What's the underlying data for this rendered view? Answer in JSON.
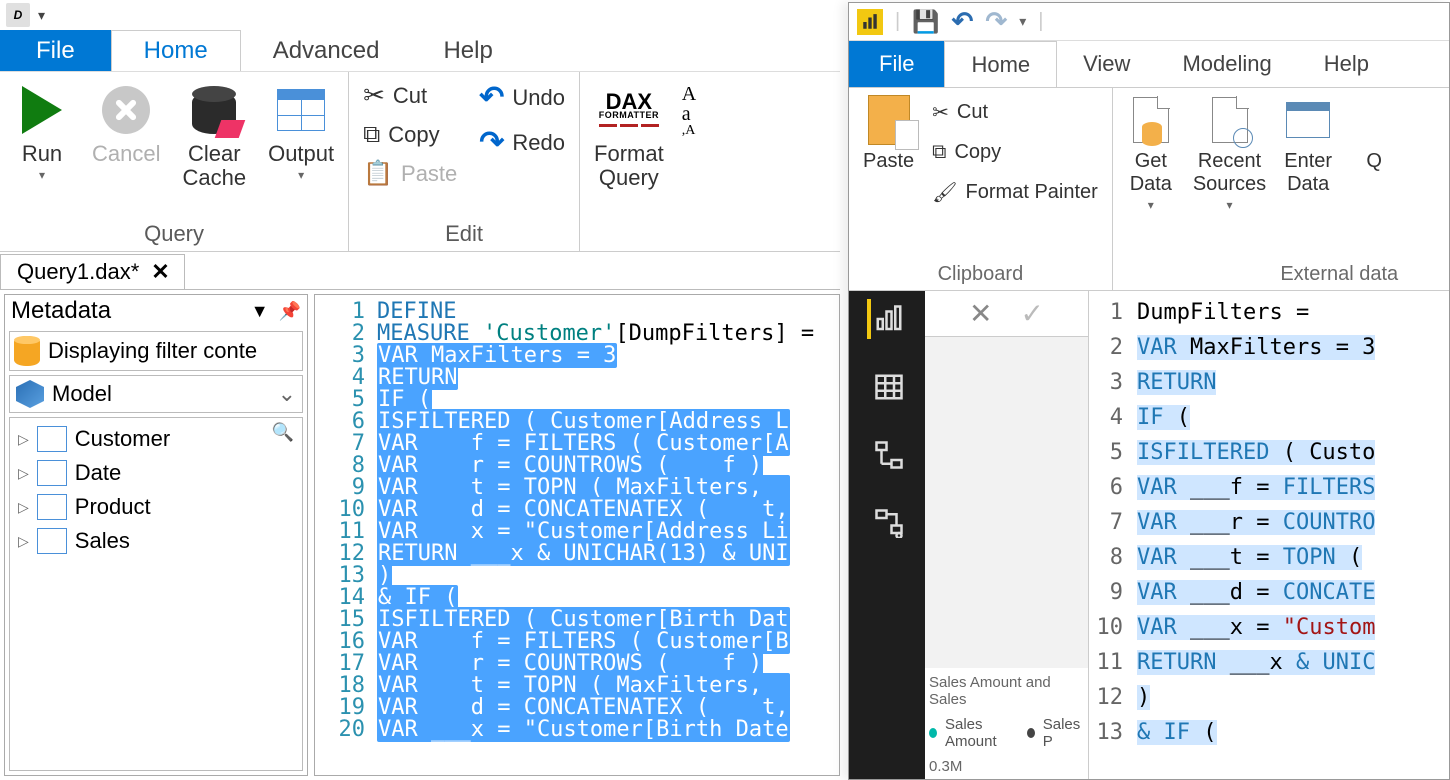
{
  "left": {
    "menu": {
      "file": "File",
      "home": "Home",
      "advanced": "Advanced",
      "help": "Help"
    },
    "ribbon": {
      "query": {
        "label": "Query",
        "run": "Run",
        "cancel": "Cancel",
        "clearCache": "Clear\nCache",
        "output": "Output"
      },
      "edit": {
        "label": "Edit",
        "cut": "Cut",
        "copy": "Copy",
        "paste": "Paste",
        "undo": "Undo",
        "redo": "Redo"
      },
      "format": {
        "formatQuery": "Format\nQuery"
      }
    },
    "docTab": {
      "title": "Query1.dax*",
      "close": "✕"
    },
    "metadata": {
      "title": "Metadata",
      "db": "Displaying filter conte",
      "model": "Model",
      "tables": [
        "Customer",
        "Date",
        "Product",
        "Sales"
      ]
    },
    "code": {
      "lines": [
        {
          "n": 1,
          "h": "<span class='kw'>DEFINE</span>"
        },
        {
          "n": 2,
          "h": "<span class='kw'>MEASURE</span> <span class='id'>'Customer'</span>[DumpFilters] ="
        },
        {
          "n": 3,
          "h": "<span class='sel'><span style='color:#fff'>VAR</span> MaxFilters = 3</span>"
        },
        {
          "n": 4,
          "h": "<span class='sel'>RETURN</span>"
        },
        {
          "n": 5,
          "h": "<span class='sel'>IF (</span>"
        },
        {
          "n": 6,
          "h": "    <span class='sel'>ISFILTERED ( Customer[Address L</span>"
        },
        {
          "n": 7,
          "h": "    <span class='sel'>VAR ___f = FILTERS ( Customer[A</span>"
        },
        {
          "n": 8,
          "h": "    <span class='sel'>VAR ___r = COUNTROWS ( ___f )</span>"
        },
        {
          "n": 9,
          "h": "    <span class='sel'>VAR ___t = TOPN ( MaxFilters, _</span>"
        },
        {
          "n": 10,
          "h": "    <span class='sel'>VAR ___d = CONCATENATEX ( ___t,</span>"
        },
        {
          "n": 11,
          "h": "    <span class='sel'>VAR ___x = \"Customer[Address Li</span>"
        },
        {
          "n": 12,
          "h": "    <span class='sel'>RETURN ___x &amp; UNICHAR(13) &amp; UNI</span>"
        },
        {
          "n": 13,
          "h": "<span class='sel'>)</span>"
        },
        {
          "n": 14,
          "h": "<span class='sel'>&amp; IF (</span>"
        },
        {
          "n": 15,
          "h": "    <span class='sel'>ISFILTERED ( Customer[Birth Dat</span>"
        },
        {
          "n": 16,
          "h": "    <span class='sel'>VAR ___f = FILTERS ( Customer[B</span>"
        },
        {
          "n": 17,
          "h": "    <span class='sel'>VAR ___r = COUNTROWS ( ___f )</span>"
        },
        {
          "n": 18,
          "h": "    <span class='sel'>VAR ___t = TOPN ( MaxFilters, _</span>"
        },
        {
          "n": 19,
          "h": "    <span class='sel'>VAR ___d = CONCATENATEX ( ___t,</span>"
        },
        {
          "n": 20,
          "h": "    <span class='sel'>VAR ___x = \"Customer[Birth Date</span>"
        }
      ]
    }
  },
  "pbi": {
    "menu": {
      "file": "File",
      "home": "Home",
      "view": "View",
      "modeling": "Modeling",
      "help": "Help"
    },
    "ribbon": {
      "clipboard": {
        "label": "Clipboard",
        "paste": "Paste",
        "cut": "Cut",
        "copy": "Copy",
        "formatPainter": "Format Painter"
      },
      "external": {
        "label": "External data",
        "getData": "Get\nData",
        "recentSources": "Recent\nSources",
        "enterData": "Enter\nData",
        "q": "Q"
      }
    },
    "canvas": {
      "title": "Sales Amount and Sales",
      "legend1": "Sales Amount",
      "legend2": "Sales P",
      "scale": "0.3M"
    },
    "code": {
      "lines": [
        {
          "n": 1,
          "h": "DumpFilters ="
        },
        {
          "n": 2,
          "h": "<span class='hl'><span class='kw'>VAR</span> MaxFilters = 3</span>"
        },
        {
          "n": 3,
          "h": "<span class='hl'><span class='kw'>RETURN</span></span>"
        },
        {
          "n": 4,
          "h": "<span class='hl'><span class='kw'>IF</span> (</span>"
        },
        {
          "n": 5,
          "h": "    <span class='hl'><span class='kw'>ISFILTERED</span> ( Custo</span>"
        },
        {
          "n": 6,
          "h": "    <span class='hl'><span class='kw'>VAR</span> ___f = <span class='kw'>FILTERS</span></span>"
        },
        {
          "n": 7,
          "h": "    <span class='hl'><span class='kw'>VAR</span> ___r = <span class='kw'>COUNTRO</span></span>"
        },
        {
          "n": 8,
          "h": "    <span class='hl'><span class='kw'>VAR</span> ___t = <span class='kw'>TOPN</span> ( </span>"
        },
        {
          "n": 9,
          "h": "    <span class='hl'><span class='kw'>VAR</span> ___d = <span class='kw'>CONCATE</span></span>"
        },
        {
          "n": 10,
          "h": "    <span class='hl'><span class='kw'>VAR</span> ___x = <span class='str'>\"Custom</span></span>"
        },
        {
          "n": 11,
          "h": "    <span class='hl'><span class='kw'>RETURN</span> ___x <span class='kw'>&amp;</span> <span class='kw'>UNIC</span></span>"
        },
        {
          "n": 12,
          "h": "<span class='hl'>)</span>"
        },
        {
          "n": 13,
          "h": "<span class='hl'><span class='kw'>&amp;</span> <span class='kw'>IF</span> (</span>"
        }
      ]
    }
  }
}
